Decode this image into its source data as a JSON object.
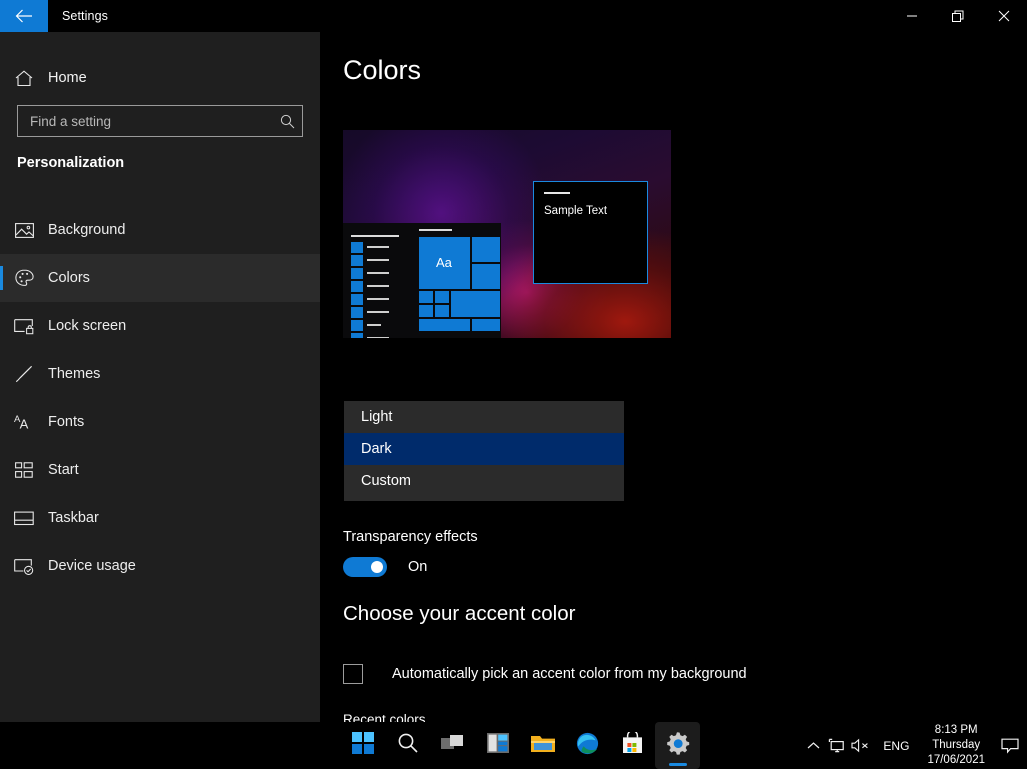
{
  "window": {
    "app_title": "Settings",
    "back_icon": "back-arrow-icon",
    "minimize_label": "Minimize",
    "restore_label": "Restore",
    "close_label": "Close",
    "accent_color": "#0f7ad4"
  },
  "sidebar": {
    "home_label": "Home",
    "home_icon": "home-icon",
    "search": {
      "placeholder": "Find a setting",
      "value": "",
      "icon": "search-icon"
    },
    "heading": "Personalization",
    "items": [
      {
        "label": "Background",
        "icon": "image-icon",
        "selected": false
      },
      {
        "label": "Colors",
        "icon": "palette-icon",
        "selected": true
      },
      {
        "label": "Lock screen",
        "icon": "lock-screen-icon",
        "selected": false
      },
      {
        "label": "Themes",
        "icon": "brush-icon",
        "selected": false
      },
      {
        "label": "Fonts",
        "icon": "fonts-icon",
        "selected": false
      },
      {
        "label": "Start",
        "icon": "start-tiles-icon",
        "selected": false
      },
      {
        "label": "Taskbar",
        "icon": "taskbar-icon",
        "selected": false
      },
      {
        "label": "Device usage",
        "icon": "device-usage-icon",
        "selected": false
      }
    ]
  },
  "main": {
    "page_title": "Colors",
    "preview": {
      "sample_text": "Sample Text",
      "tile_text": "Aa"
    },
    "transparency": {
      "label": "Transparency effects",
      "state": "On",
      "enabled": true
    },
    "accent": {
      "section_title": "Choose your accent color",
      "auto_pick_label": "Automatically pick an accent color from my background",
      "auto_pick_checked": false,
      "recent_label": "Recent colors",
      "recent_colors": [
        "#0f7ad4",
        "#00b7c3",
        "#4a4a48",
        "#e81123",
        "#e3008c"
      ]
    },
    "dropdown": {
      "open": true,
      "selected": "Dark",
      "options": [
        {
          "label": "Light",
          "selected": false
        },
        {
          "label": "Dark",
          "selected": true
        },
        {
          "label": "Custom",
          "selected": false
        }
      ]
    }
  },
  "taskbar": {
    "buttons": [
      {
        "name": "start-button",
        "label": "Start"
      },
      {
        "name": "search-button",
        "label": "Search"
      },
      {
        "name": "task-view-button",
        "label": "Task View"
      },
      {
        "name": "widgets-button",
        "label": "Widgets"
      },
      {
        "name": "file-explorer-button",
        "label": "File Explorer"
      },
      {
        "name": "edge-button",
        "label": "Microsoft Edge"
      },
      {
        "name": "store-button",
        "label": "Microsoft Store"
      },
      {
        "name": "settings-button",
        "label": "Settings",
        "active": true
      }
    ],
    "tray": {
      "chevron_icon": "chevron-up-icon",
      "network_icon": "network-icon",
      "volume_icon": "volume-muted-icon",
      "language": "ENG",
      "time": "8:13 PM",
      "day": "Thursday",
      "date": "17/06/2021",
      "notifications_icon": "notification-icon"
    }
  }
}
